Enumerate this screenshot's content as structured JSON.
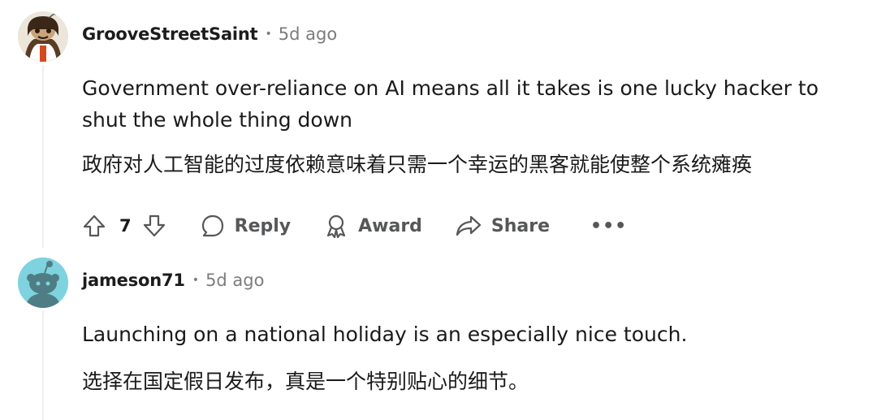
{
  "comments": [
    {
      "username": "GrooveStreetSaint",
      "separator": "•",
      "time": "5d ago",
      "text_en": "Government over-reliance on AI means all it takes is one lucky hacker to shut the whole thing down",
      "text_zh": "政府对人工智能的过度依赖意味着只需一个幸运的黑客就能使整个系统瘫痪",
      "score": "7",
      "avatar": "avatar-icon"
    },
    {
      "username": "jameson71",
      "separator": "•",
      "time": "5d ago",
      "text_en": "Launching on a national holiday is an especially nice touch.",
      "text_zh": "选择在国定假日发布，真是一个特别贴心的细节。",
      "avatar": "avatar-icon"
    }
  ],
  "actions": {
    "reply": "Reply",
    "award": "Award",
    "share": "Share",
    "more": "•••"
  },
  "colors": {
    "text": "#1a1a1b",
    "muted": "#7c7c7c",
    "action": "#555758",
    "avatar2_bg": "#7fd3df"
  }
}
